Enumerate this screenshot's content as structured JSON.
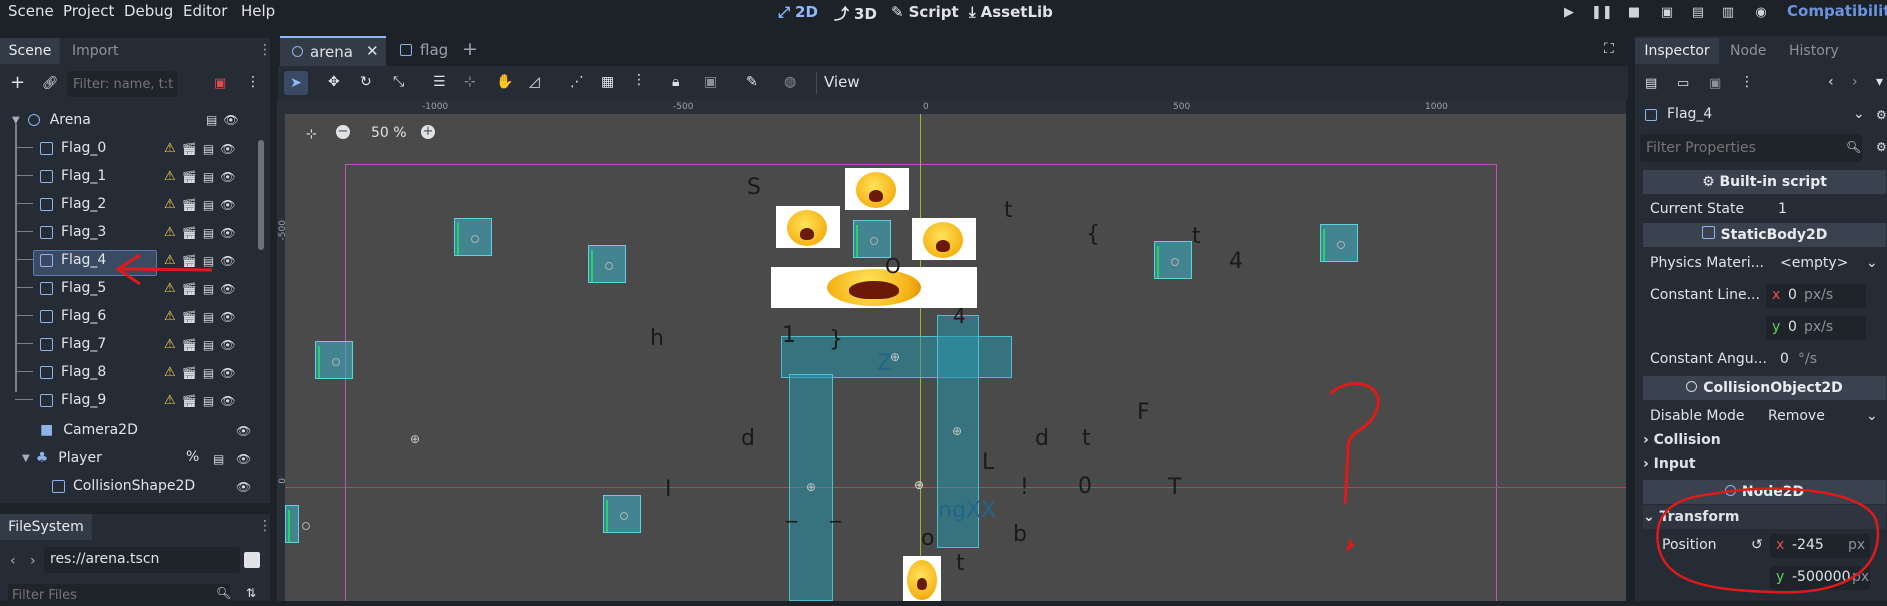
{
  "menu": {
    "items": [
      "Scene",
      "Project",
      "Debug",
      "Editor",
      "Help"
    ]
  },
  "main_tabs": [
    {
      "label": "2D",
      "icon": "2d-icon",
      "active": true
    },
    {
      "label": "3D",
      "icon": "3d-icon",
      "active": false
    },
    {
      "label": "Script",
      "icon": "script-icon",
      "active": false
    },
    {
      "label": "AssetLib",
      "icon": "assetlib-icon",
      "active": false
    }
  ],
  "renderer": "Compatibility",
  "scene_dock": {
    "tabs": [
      "Scene",
      "Import"
    ],
    "filter_placeholder": "Filter: name, t:t",
    "root": "Arena",
    "nodes": [
      "Flag_0",
      "Flag_1",
      "Flag_2",
      "Flag_3",
      "Flag_4",
      "Flag_5",
      "Flag_6",
      "Flag_7",
      "Flag_8",
      "Flag_9",
      "Camera2D",
      "Player",
      "CollisionShape2D"
    ],
    "selected": "Flag_4",
    "player_badge": "%"
  },
  "filesystem": {
    "tab": "FileSystem",
    "path": "res://arena.tscn",
    "filter_placeholder": "Filter Files"
  },
  "editor_tabs": [
    {
      "label": "arena",
      "active": true
    },
    {
      "label": "flag",
      "active": false
    }
  ],
  "toolbar": {
    "view_label": "View"
  },
  "viewport": {
    "zoom": "50 %",
    "ruler_labels": [
      "-1000",
      "-500",
      "0",
      "500",
      "1000"
    ],
    "v_ruler_labels": [
      "-500",
      "0"
    ],
    "glyphs": [
      "S",
      "t",
      "{",
      "t",
      "4",
      "O",
      "4",
      "h",
      "1",
      "}",
      "Z",
      "F",
      "d",
      "d",
      "t",
      "L",
      "I",
      "!",
      "0",
      "T",
      "_",
      "_",
      "ngXX",
      "o",
      "b",
      "t"
    ]
  },
  "inspector": {
    "tabs": [
      "Inspector",
      "Node",
      "History"
    ],
    "object_name": "Flag_4",
    "filter_placeholder": "Filter Properties",
    "builtin_script": "Built-in script",
    "current_state_label": "Current State",
    "current_state_value": "1",
    "staticbody": "StaticBody2D",
    "physics_material_label": "Physics Materi...",
    "physics_material_value": "<empty>",
    "const_linear_label": "Constant Line...",
    "linear_x": "0",
    "linear_y": "0",
    "linear_unit": "px/s",
    "const_angular_label": "Constant Angu...",
    "angular_value": "0",
    "angular_unit": "°/s",
    "collisionobject": "CollisionObject2D",
    "disable_mode_label": "Disable Mode",
    "disable_mode_value": "Remove",
    "collision": "Collision",
    "input": "Input",
    "node2d": "Node2D",
    "transform": "Transform",
    "position_label": "Position",
    "pos_x": "-245",
    "pos_y": "-500000",
    "pos_unit": "px",
    "axis_x": "x",
    "axis_y": "y"
  },
  "colors": {
    "accent": "#8fb8ff",
    "annotation": "#e01a1a",
    "selection": "#3b4a63"
  }
}
